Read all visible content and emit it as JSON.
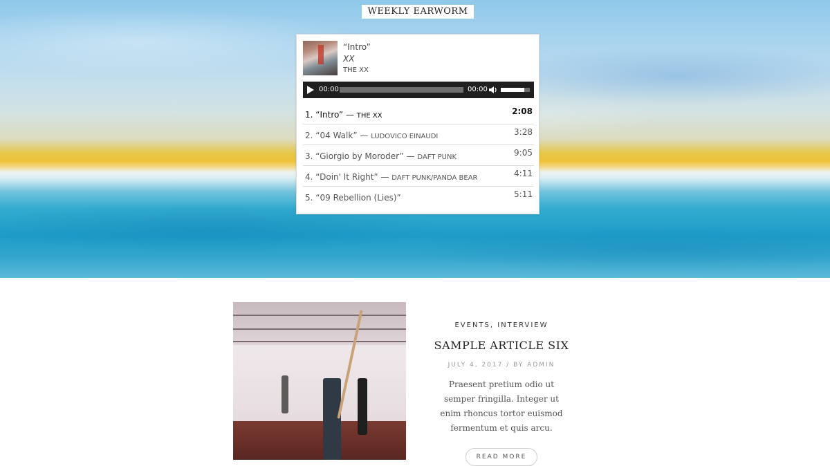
{
  "widget": {
    "title": "WEEKLY EARWORM"
  },
  "now_playing": {
    "title": "“Intro”",
    "album": "XX",
    "artist": "THE XX",
    "cover_icon": "album-cover"
  },
  "audio": {
    "current_time": "00:00",
    "duration": "00:00",
    "progress": 0,
    "volume_level": 0.8
  },
  "tracks": [
    {
      "number": "1.",
      "title": "“Intro”",
      "artist": "THE XX",
      "duration": "2:08",
      "active": true
    },
    {
      "number": "2.",
      "title": "“04 Walk”",
      "artist": "LUDOVICO EINAUDI",
      "duration": "3:28",
      "active": false
    },
    {
      "number": "3.",
      "title": "“Giorgio by Moroder”",
      "artist": "DAFT PUNK",
      "duration": "9:05",
      "active": false
    },
    {
      "number": "4.",
      "title": "“Doin' It Right”",
      "artist": "DAFT PUNK/PANDA BEAR",
      "duration": "4:11",
      "active": false
    },
    {
      "number": "5.",
      "title": "“09 Rebellion (Lies)”",
      "artist": "",
      "duration": "5:11",
      "active": false
    }
  ],
  "article": {
    "categories": "EVENTS, INTERVIEW",
    "title": "SAMPLE ARTICLE SIX",
    "byline": "JULY 4, 2017 / BY ADMIN",
    "excerpt": "Praesent pretium odio ut semper fringilla. Integer ut enim rhoncus tortor euismod fermentum et quis arcu.",
    "read_more": "READ MORE"
  },
  "colors": {
    "player_bar": "#1f1f1f",
    "accent_text": "#222222",
    "muted_text": "#999999"
  }
}
